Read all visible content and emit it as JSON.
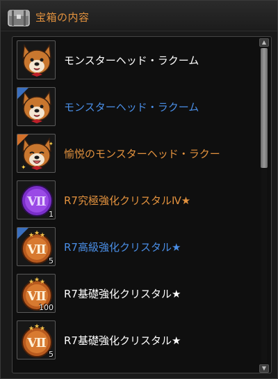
{
  "window": {
    "title": "宝箱の内容",
    "title_color": "#e3923e"
  },
  "items": [
    {
      "name": "モンスターヘッド・ラクーム",
      "color": "#ffffff",
      "icon": "monster-head-icon",
      "grade": "",
      "qty": ""
    },
    {
      "name": "モンスターヘッド・ラクーム",
      "color": "#4a8ee6",
      "icon": "monster-head-icon",
      "grade": "blue",
      "qty": ""
    },
    {
      "name": "愉悦のモンスターヘッド・ラクー",
      "color": "#e3923e",
      "icon": "joyful-monster-head-icon",
      "grade": "orange",
      "qty": ""
    },
    {
      "name": "R7究極強化クリスタルⅣ★",
      "color": "#e3923e",
      "icon": "purple-crystal-icon",
      "grade": "",
      "qty": "1"
    },
    {
      "name": "R7高級強化クリスタル★",
      "color": "#4a8ee6",
      "icon": "bronze-crystal-icon",
      "grade": "blue",
      "qty": "5"
    },
    {
      "name": "R7基礎強化クリスタル★",
      "color": "#ffffff",
      "icon": "bronze-crystal-icon",
      "grade": "",
      "qty": "100"
    },
    {
      "name": "R7基礎強化クリスタル★",
      "color": "#ffffff",
      "icon": "bronze-crystal-icon",
      "grade": "",
      "qty": "5"
    }
  ],
  "scrollbar": {
    "thumb_fraction": 0.38
  }
}
